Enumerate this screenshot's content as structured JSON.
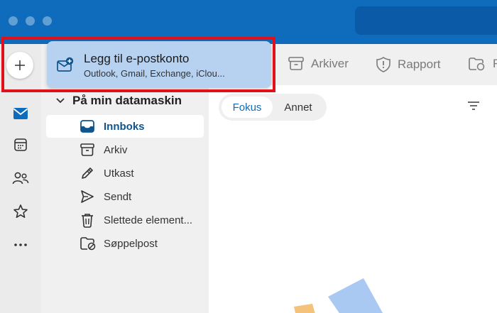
{
  "popup": {
    "title": "Legg til e-postkonto",
    "subtitle": "Outlook, Gmail, Exchange, iClou..."
  },
  "toolbar": {
    "archive_label": "Arkiver",
    "report_label": "Rapport",
    "move_label": "F"
  },
  "folders": {
    "section_title": "På min datamaskin",
    "items": [
      {
        "label": "Innboks",
        "icon": "inbox-icon",
        "active": true
      },
      {
        "label": "Arkiv",
        "icon": "archive-icon",
        "active": false
      },
      {
        "label": "Utkast",
        "icon": "pencil-icon",
        "active": false
      },
      {
        "label": "Sendt",
        "icon": "send-icon",
        "active": false
      },
      {
        "label": "Slettede element...",
        "icon": "trash-icon",
        "active": false
      },
      {
        "label": "Søppelpost",
        "icon": "junk-folder-icon",
        "active": false
      }
    ]
  },
  "list": {
    "tab_focused": "Fokus",
    "tab_other": "Annet"
  },
  "colors": {
    "accent": "#0f6cbd",
    "popup_bg": "#b7d2f0",
    "highlight": "#e0111b"
  }
}
